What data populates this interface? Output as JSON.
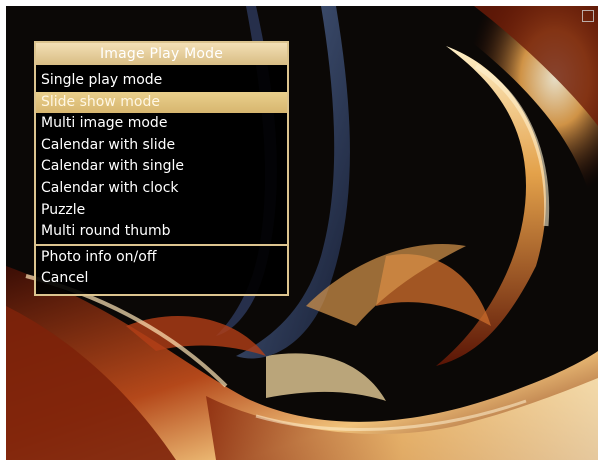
{
  "menu": {
    "title": "Image Play Mode",
    "items": [
      {
        "label": "Single play mode"
      },
      {
        "label": "Slide show mode",
        "selected": true
      },
      {
        "label": "Multi image mode"
      },
      {
        "label": "Calendar with slide"
      },
      {
        "label": "Calendar with single"
      },
      {
        "label": "Calendar with clock"
      },
      {
        "label": "Puzzle"
      },
      {
        "label": "Multi round thumb"
      }
    ],
    "secondary_items": [
      {
        "label": "Photo info on/off"
      },
      {
        "label": "Cancel"
      }
    ],
    "accent_color": "#dcc48f"
  }
}
